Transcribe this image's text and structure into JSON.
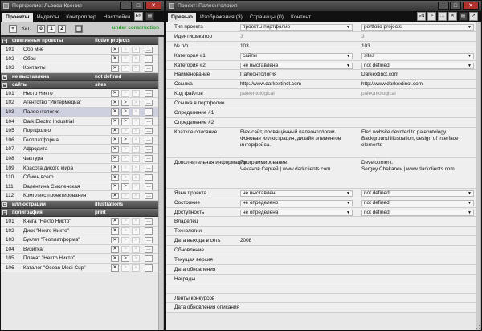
{
  "left": {
    "title": "Портфолио: Львова Ксения",
    "tabs": [
      "Проекты",
      "Индексы",
      "Контроллер",
      "Настройки"
    ],
    "lang": "EN",
    "toolbar": {
      "add": "+",
      "cat_label": "Кат:",
      "cats": [
        "0",
        "1",
        "2"
      ],
      "status": "under construction"
    },
    "sections": [
      {
        "ru": "фиктивные проекты",
        "en": "fictive projects",
        "rows": [
          {
            "n": "101",
            "t": "Обо мне",
            "up": false
          },
          {
            "n": "102",
            "t": "Обои",
            "up": false
          },
          {
            "n": "103",
            "t": "Контакты",
            "up": false
          }
        ]
      },
      {
        "ru": "не выставлена",
        "en": "not defined",
        "rows": []
      },
      {
        "ru": "сайты",
        "en": "sites",
        "rows": [
          {
            "n": "101",
            "t": "Некто Никто",
            "up": false
          },
          {
            "n": "102",
            "t": "Агентство \"Интермедиа\"",
            "up": true
          },
          {
            "n": "103",
            "t": "Палеонтология",
            "up": true,
            "sel": true
          },
          {
            "n": "104",
            "t": "Dark Electro Industrial",
            "up": true
          },
          {
            "n": "105",
            "t": "Портфолио",
            "up": false
          },
          {
            "n": "106",
            "t": "Геоплатформа",
            "up": true
          },
          {
            "n": "107",
            "t": "Афродита",
            "up": false
          },
          {
            "n": "108",
            "t": "Фактура",
            "up": false
          },
          {
            "n": "109",
            "t": "Красота дикого мира",
            "up": false
          },
          {
            "n": "110",
            "t": "Обмен всего",
            "up": false
          },
          {
            "n": "111",
            "t": "Валентина Смоленская",
            "up": true
          },
          {
            "n": "112",
            "t": "Комплекс проектирования",
            "up": false
          }
        ]
      },
      {
        "ru": "иллюстрации",
        "en": "illustrations",
        "rows": []
      },
      {
        "ru": "полиграфия",
        "en": "print",
        "rows": [
          {
            "n": "101",
            "t": "Книга \"Некто Никто\"",
            "up": false
          },
          {
            "n": "102",
            "t": "Диск \"Некто Никто\"",
            "up": false
          },
          {
            "n": "103",
            "t": "Буклет \"Геоплатформа\"",
            "up": false
          },
          {
            "n": "104",
            "t": "Визитка",
            "up": false
          },
          {
            "n": "105",
            "t": "Плакат \"Некто Никто\"",
            "up": true
          },
          {
            "n": "106",
            "t": "Каталог \"Ocean Medi Cup\"",
            "up": false
          }
        ]
      }
    ]
  },
  "right": {
    "title": "Проект: Палеонтология",
    "tabs": [
      "Превью",
      "Изображения (3)",
      "Страницы (0)",
      "Контент"
    ],
    "lang": "EN",
    "fields": [
      {
        "label": "Тип проекта",
        "ru": "проекты портфолио",
        "en": "portfolio projects",
        "sel": true
      },
      {
        "label": "Идентификатор",
        "ru": "3",
        "en": "3",
        "gray": true
      },
      {
        "label": "№ п/п",
        "ru": "103",
        "en": "103"
      },
      {
        "label": "Категория #1",
        "ru": "сайты",
        "en": "sites",
        "sel": true
      },
      {
        "label": "Категория #2",
        "ru": "не выставлена",
        "en": "not defined",
        "sel": true
      },
      {
        "label": "Наименование",
        "ru": "Палеонтология",
        "en": "Darkextinct.com"
      },
      {
        "label": "Ссылка",
        "ru": "http://www.darkextinct.com",
        "en": "http://www.darkextinct.com"
      },
      {
        "label": "Код файлов",
        "ru": "paleontological",
        "en": "paleontological",
        "gray": true
      },
      {
        "label": "Ссылка в портфолио",
        "ru": "",
        "en": ""
      },
      {
        "label": "Определение #1",
        "ru": "",
        "en": ""
      },
      {
        "label": "Определение #2",
        "ru": "",
        "en": ""
      },
      {
        "label": "Краткое описание",
        "ru": "Flex-сайт, посвящённый палеонтологии. Фоновая иллюстрация, дизайн элементов интерфейса.",
        "en": "Flex website devoted to paleontology. Background illustration, design of interface elements",
        "tall": true
      },
      {
        "label": "Дополнительная информация",
        "ru": "Программирование:\nЧеканов Сергей | www.darkclients.com",
        "en": "Development:\nSergey Chekanov | www.darkclients.com",
        "tall": true
      },
      {
        "label": "Язык проекта",
        "ru": "не выставлен",
        "en": "not defined",
        "sel": true
      },
      {
        "label": "Состояние",
        "ru": "не определено",
        "en": "not defined",
        "sel": true
      },
      {
        "label": "Доступность",
        "ru": "не определена",
        "en": "not defined",
        "sel": true
      },
      {
        "label": "Владелец",
        "ru": "",
        "en": ""
      },
      {
        "label": "Технологии",
        "ru": "",
        "en": ""
      },
      {
        "label": "Дата выхода в сеть",
        "ru": "2008",
        "en": ""
      },
      {
        "label": "Обновление",
        "ru": "",
        "en": ""
      },
      {
        "label": "Текущая версия",
        "ru": "",
        "en": ""
      },
      {
        "label": "Дата обновления",
        "ru": "",
        "en": ""
      },
      {
        "label": "Награды",
        "ru": "",
        "en": ""
      },
      {
        "label": "",
        "ru": "",
        "en": ""
      },
      {
        "label": "Ленты конкурсов",
        "ru": "",
        "en": ""
      },
      {
        "label": "Дата обновления описания",
        "ru": "",
        "en": ""
      }
    ]
  }
}
